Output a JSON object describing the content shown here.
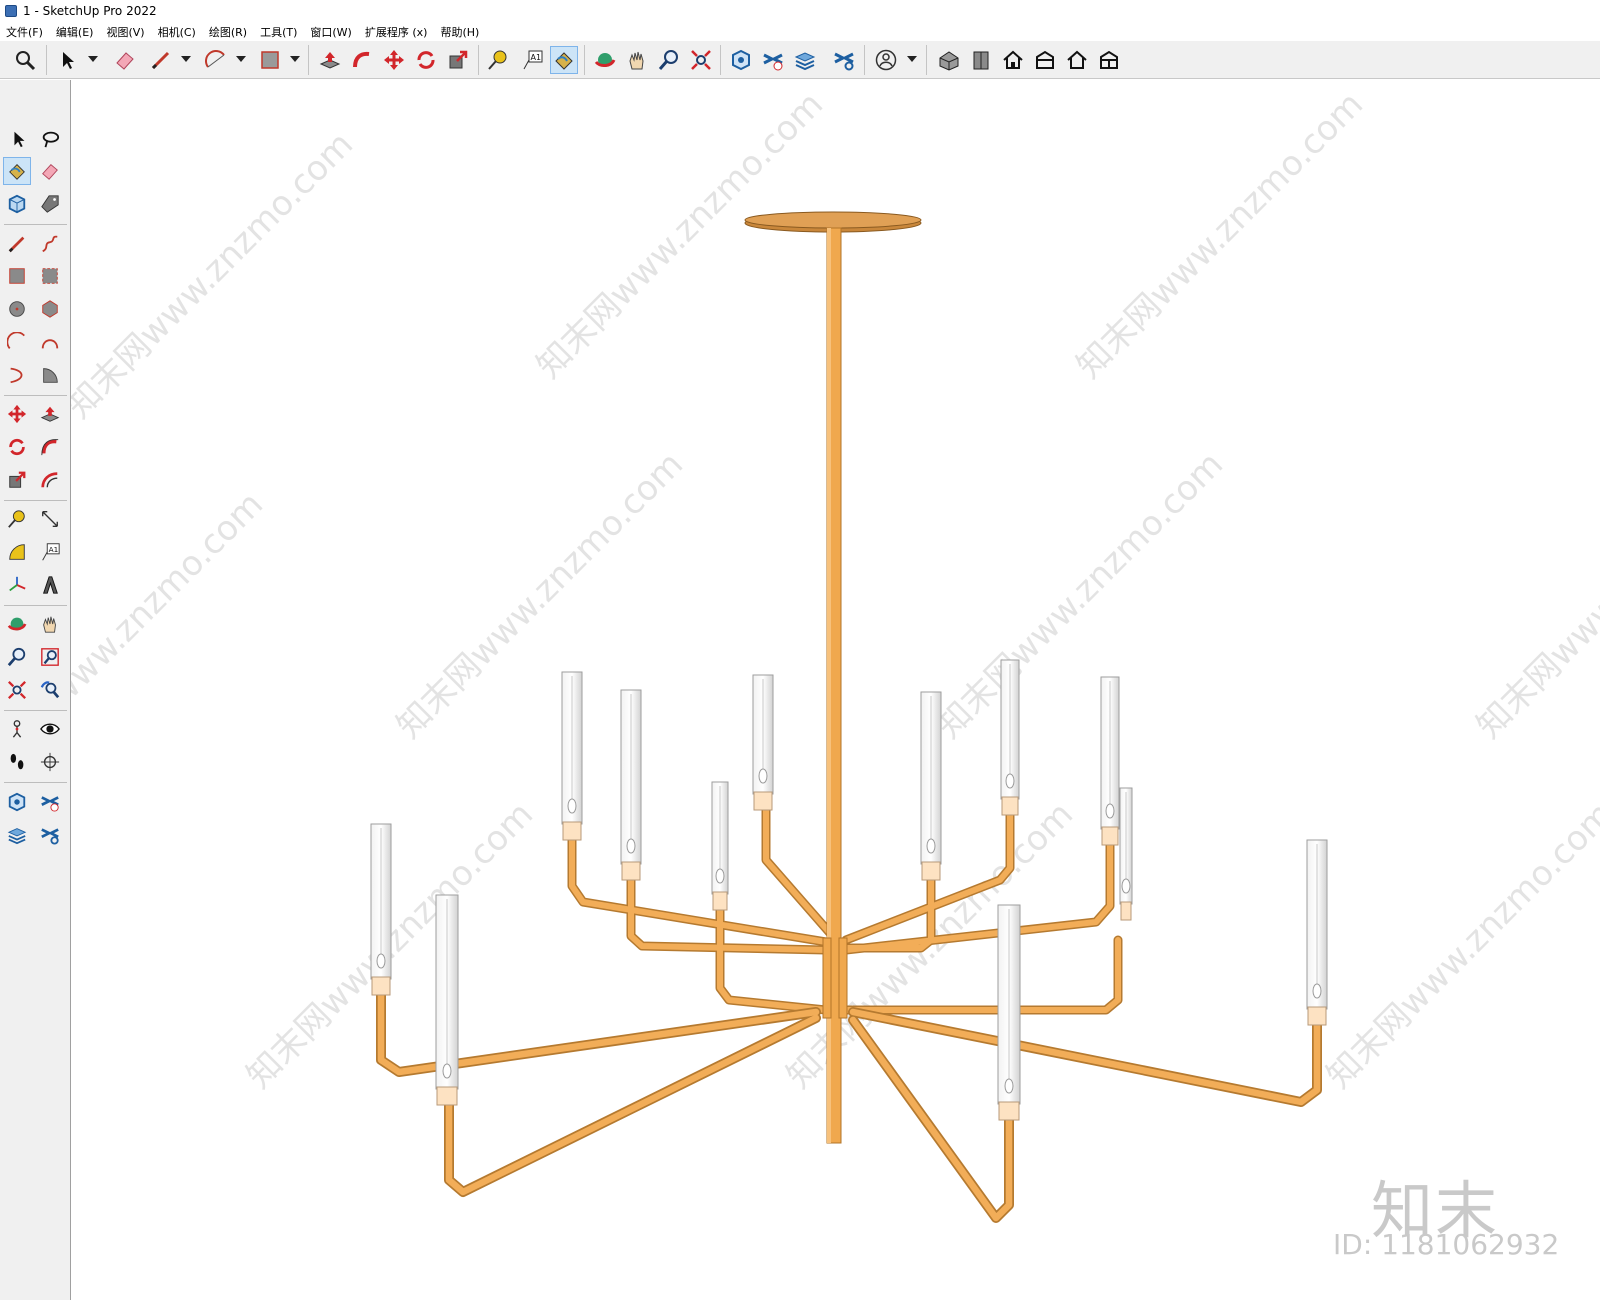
{
  "window": {
    "title": "1 - SketchUp Pro 2022"
  },
  "menu": {
    "items": [
      "文件(F)",
      "编辑(E)",
      "视图(V)",
      "相机(C)",
      "绘图(R)",
      "工具(T)",
      "窗口(W)",
      "扩展程序 (x)",
      "帮助(H)"
    ]
  },
  "toolbar": {
    "items": [
      {
        "icon": "zoom-icon"
      },
      {
        "icon": "select-icon"
      },
      {
        "icon": "eraser-icon"
      },
      {
        "icon": "pencil-icon"
      },
      {
        "icon": "arc-icon"
      },
      {
        "icon": "rectangle-icon"
      },
      {
        "icon": "push-pull-icon"
      },
      {
        "icon": "follow-me-icon"
      },
      {
        "icon": "move-icon"
      },
      {
        "icon": "rotate-icon"
      },
      {
        "icon": "scale-icon"
      },
      {
        "icon": "tape-measure-icon"
      },
      {
        "icon": "text-icon"
      },
      {
        "icon": "paint-bucket-icon"
      },
      {
        "icon": "orbit-icon"
      },
      {
        "icon": "pan-icon"
      },
      {
        "icon": "zoom-tool-icon"
      },
      {
        "icon": "zoom-extents-icon"
      },
      {
        "icon": "warehouse-icon"
      },
      {
        "icon": "extension-warehouse-icon"
      },
      {
        "icon": "layout-icon"
      },
      {
        "icon": "extension-manager-icon"
      },
      {
        "icon": "account-icon"
      },
      {
        "icon": "iso-view-icon"
      },
      {
        "icon": "top-view-icon"
      },
      {
        "icon": "front-view-icon"
      },
      {
        "icon": "right-view-icon"
      },
      {
        "icon": "back-view-icon"
      },
      {
        "icon": "left-view-icon"
      }
    ],
    "text_tool_label": "A1"
  },
  "sidebar": {
    "text_tool_label": "A1"
  },
  "watermark": {
    "url_text": "知末网www.znzmo.com",
    "brand": "知末",
    "id_text": "ID: 1181062932"
  },
  "colors": {
    "brass": "#f0a84e",
    "brass_dark": "#c98a3a",
    "glass": "#e6e6e6",
    "accent_selected": "#cce4f7",
    "toolbar_bg": "#f0f0f0"
  }
}
